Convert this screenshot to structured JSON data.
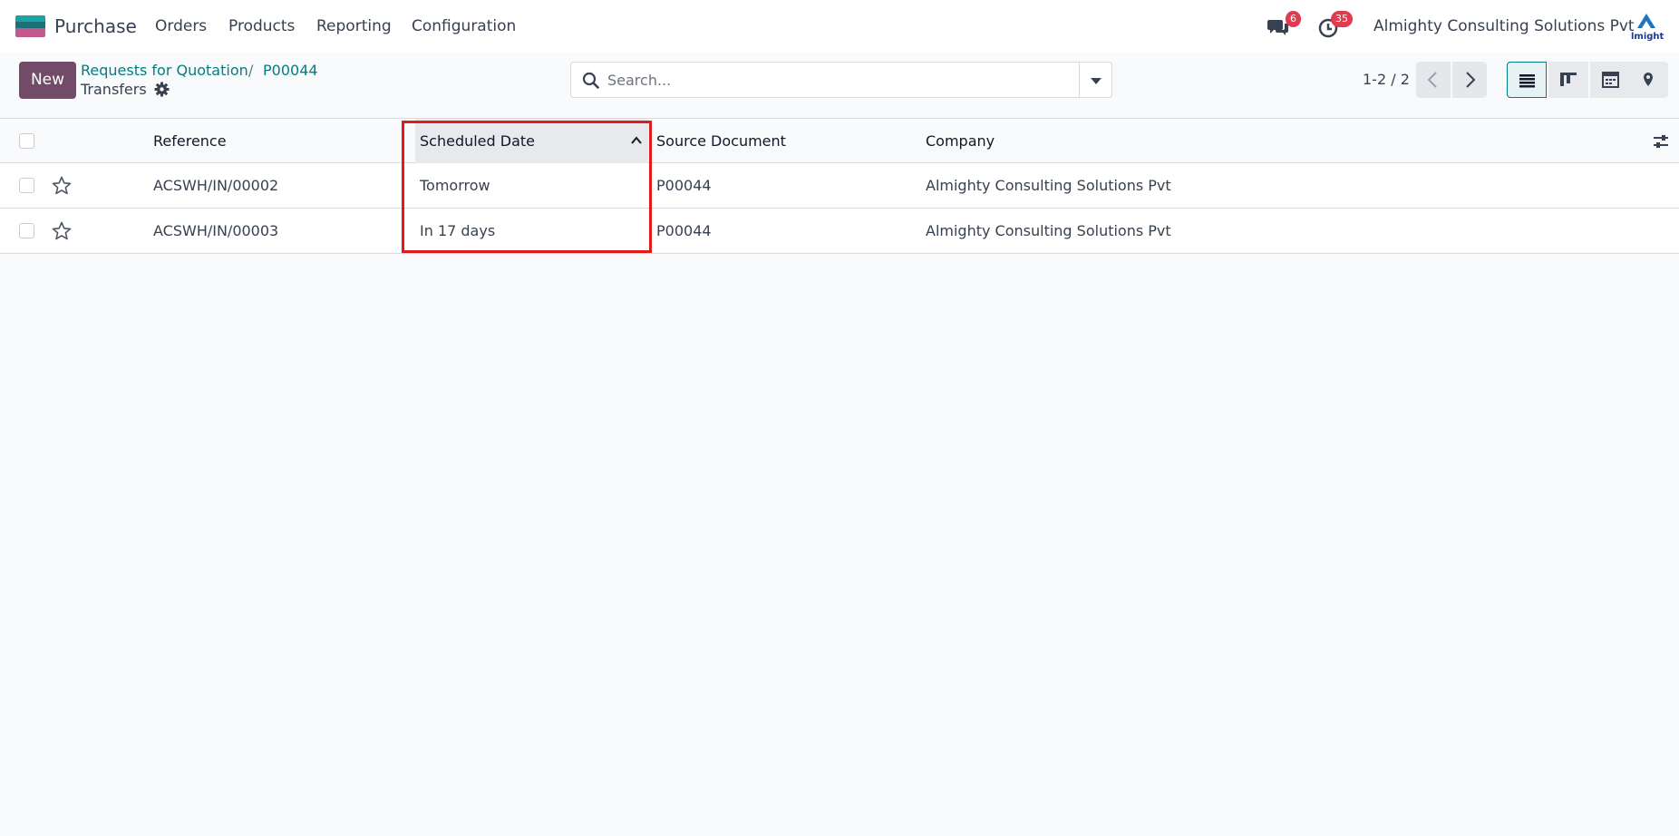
{
  "topnav": {
    "app_name": "Purchase",
    "menu": [
      "Orders",
      "Products",
      "Reporting",
      "Configuration"
    ],
    "messages_badge": "6",
    "activities_badge": "35",
    "company": "Almighty Consulting Solutions Pvt",
    "logo_text": "lmight"
  },
  "control": {
    "new_label": "New",
    "breadcrumb": [
      "Requests for Quotation",
      "P00044"
    ],
    "breadcrumb_sep": "/",
    "subtitle": "Transfers",
    "search_placeholder": "Search...",
    "pager": "1-2 / 2"
  },
  "table": {
    "columns": [
      "Reference",
      "Scheduled Date",
      "Source Document",
      "Company"
    ],
    "rows": [
      {
        "reference": "ACSWH/IN/00002",
        "scheduled": "Tomorrow",
        "source": "P00044",
        "company": "Almighty Consulting Solutions Pvt"
      },
      {
        "reference": "ACSWH/IN/00003",
        "scheduled": "In 17 days",
        "source": "P00044",
        "company": "Almighty Consulting Solutions Pvt"
      }
    ]
  },
  "colors": {
    "primary": "#714b67",
    "link": "#017e84",
    "badge": "#e23a4e",
    "highlight": "#e01b1b"
  }
}
